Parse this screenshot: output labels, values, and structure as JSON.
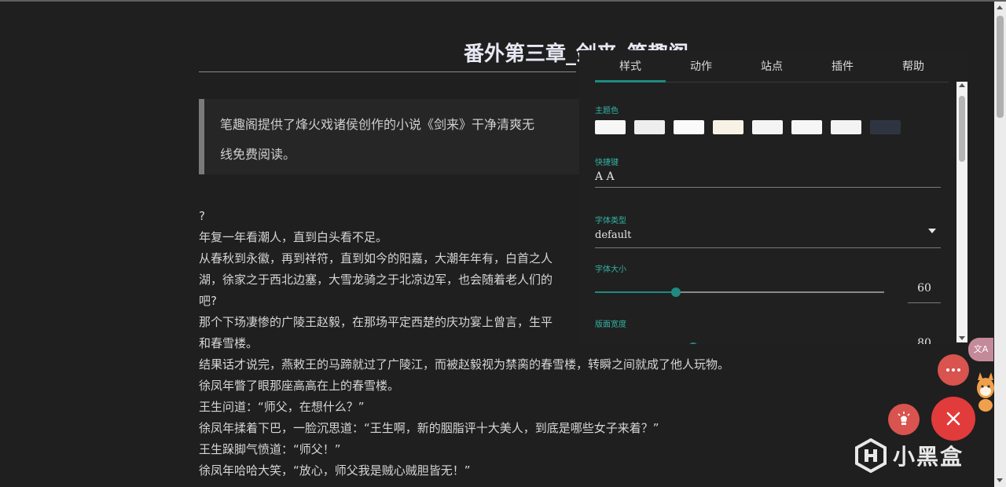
{
  "reader": {
    "chapter_title": "番外第三章_剑来_笔趣阁",
    "quote_lines": [
      "笔趣阁提供了烽火戏诸侯创作的小说《剑来》干净清爽无",
      "线免费阅读。"
    ],
    "body_lines": [
      "?",
      "年复一年看潮人，直到白头看不足。",
      "从春秋到永徽，再到祥符，直到如今的阳嘉，大潮年年有，白首之人",
      "湖，徐家之于西北边塞，大雪龙骑之于北凉边军，也会随着老人们的",
      "吧?",
      "那个下场凄惨的广陵王赵毅，在那场平定西楚的庆功宴上曾言，生平",
      "和春雪楼。",
      "结果话才说完，燕敕王的马蹄就过了广陵江，而被赵毅视为禁脔的春雪楼，转瞬之间就成了他人玩物。",
      "徐凤年瞥了眼那座高高在上的春雪楼。",
      "王生问道：“师父，在想什么？”",
      "徐凤年揉着下巴，一脸沉思道：“王生啊，新的胭脂评十大美人，到底是哪些女子来着？”",
      "王生跺脚气愤道：“师父！”",
      "徐凤年哈哈大笑，“放心，师父我是贼心贼胆皆无！”"
    ]
  },
  "panel": {
    "tabs": [
      "样式",
      "动作",
      "站点",
      "插件",
      "帮助"
    ],
    "active_tab": "样式",
    "accent_color": "#1f8a80",
    "theme_label": "主题色",
    "theme_swatches": [
      "#f7f7f7",
      "#eeeeee",
      "#fbfbfb",
      "#f8f1e6",
      "#f4f4f4",
      "#f6f6f6",
      "#f3f3f3",
      "#2f3540"
    ],
    "shortcut_label": "快捷键",
    "shortcut_value": "A A",
    "font_type_label": "字体类型",
    "font_type_value": "default",
    "font_size_label": "字体大小",
    "font_size_value": "60",
    "font_size_fraction": 0.28,
    "page_width_label": "版面宽度",
    "page_width_value": "80",
    "page_width_fraction": 0.34
  },
  "floating": {
    "translate_badge": "文A",
    "watermark": "小黑盒"
  }
}
